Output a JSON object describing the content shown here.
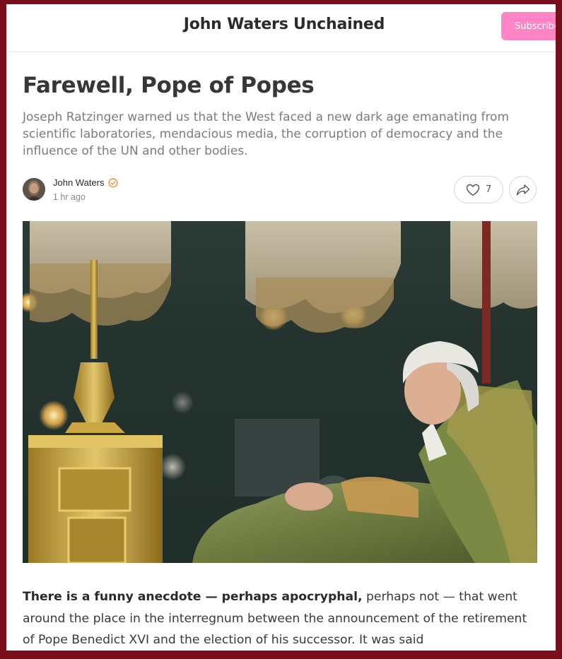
{
  "publication": {
    "name": "John Waters Unchained",
    "subscribe_label": "Subscribe"
  },
  "post": {
    "title": "Farewell, Pope of Popes",
    "subtitle": "Joseph Ratzinger warned us that the West faced a new dark age emanating from scientific laboratories, mendacious media, the corruption of democracy and the influence of the UN and other bodies.",
    "author": "John Waters",
    "date": "1 hr ago",
    "like_count": "7",
    "body_lead": "There is a funny anecdote — perhaps apocryphal,",
    "body_rest": " perhaps not — that went around the place in the interregnum between the announcement of the retirement of Pope Benedict XVI and the election of his successor. It was said"
  },
  "icons": {
    "verified": "verified-badge-icon",
    "like": "heart-icon",
    "share": "share-arrow-icon"
  },
  "colors": {
    "subscribe": "#ff84c6",
    "frame": "#7a0e1a",
    "verified": "#f08a2c"
  }
}
